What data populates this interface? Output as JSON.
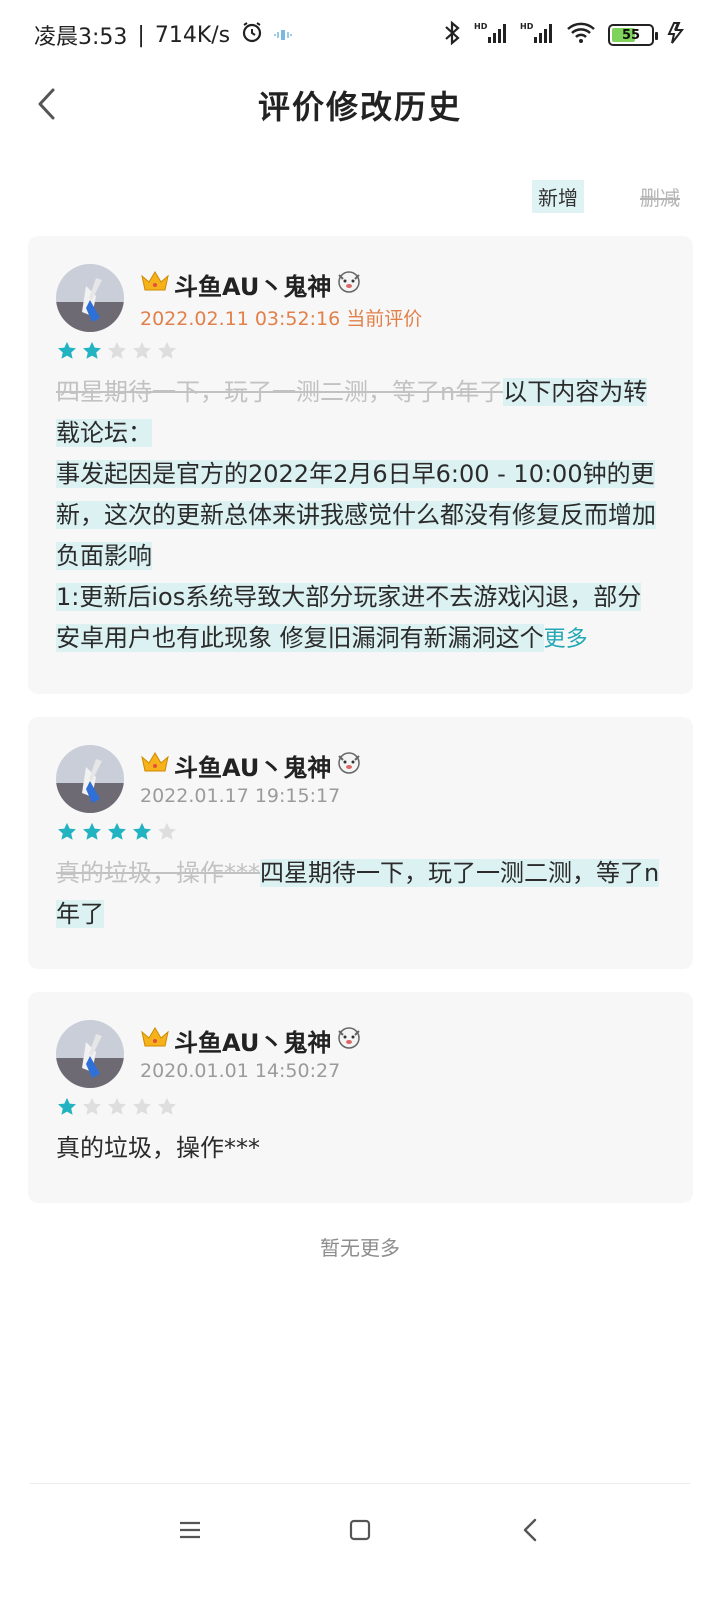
{
  "status_bar": {
    "time": "凌晨3:53",
    "speed": "714K/s",
    "battery": "55",
    "icons": [
      "alarm-icon",
      "vibrate-icon",
      "bluetooth-icon",
      "signal-icon",
      "wifi-icon",
      "battery-icon",
      "charging-icon"
    ]
  },
  "header": {
    "title": "评价修改历史",
    "back_icon": "chevron-left-icon"
  },
  "legend": {
    "added_label": "新增",
    "deleted_label": "删减"
  },
  "colors": {
    "accent": "#22a9b5",
    "added_bg": "#dcf1f2",
    "deleted_text": "#c2c2c2",
    "current_timestamp": "#e2804a",
    "star_filled": "#22b3c2",
    "star_empty": "#dedede"
  },
  "reviews": [
    {
      "username": "斗鱼AU丶鬼神",
      "timestamp": "2022.02.11 03:52:16",
      "current_label": "当前评价",
      "rating": 2,
      "deleted_text": "四星期待一下，玩了一测二测，等了n年了",
      "added_text": "以下内容为转载论坛：\n事发起因是官方的2022年2月6日早6:00 - 10:00钟的更新，这次的更新总体来讲我感觉什么都没有修复反而增加负面影响\n1:更新后ios系统导致大部分玩家进不去游戏闪退，部分安卓用户也有此现象 修复旧漏洞有新漏洞这个",
      "more_label": "更多"
    },
    {
      "username": "斗鱼AU丶鬼神",
      "timestamp": "2022.01.17 19:15:17",
      "rating": 4,
      "deleted_text": "真的垃圾，操作***",
      "added_text": "四星期待一下，玩了一测二测，等了n年了"
    },
    {
      "username": "斗鱼AU丶鬼神",
      "timestamp": "2020.01.01 14:50:27",
      "rating": 1,
      "plain_text": "真的垃圾，操作***"
    }
  ],
  "footer": {
    "no_more": "暂无更多"
  },
  "nav": {
    "icons": [
      "menu-icon",
      "home-icon",
      "back-icon"
    ]
  }
}
